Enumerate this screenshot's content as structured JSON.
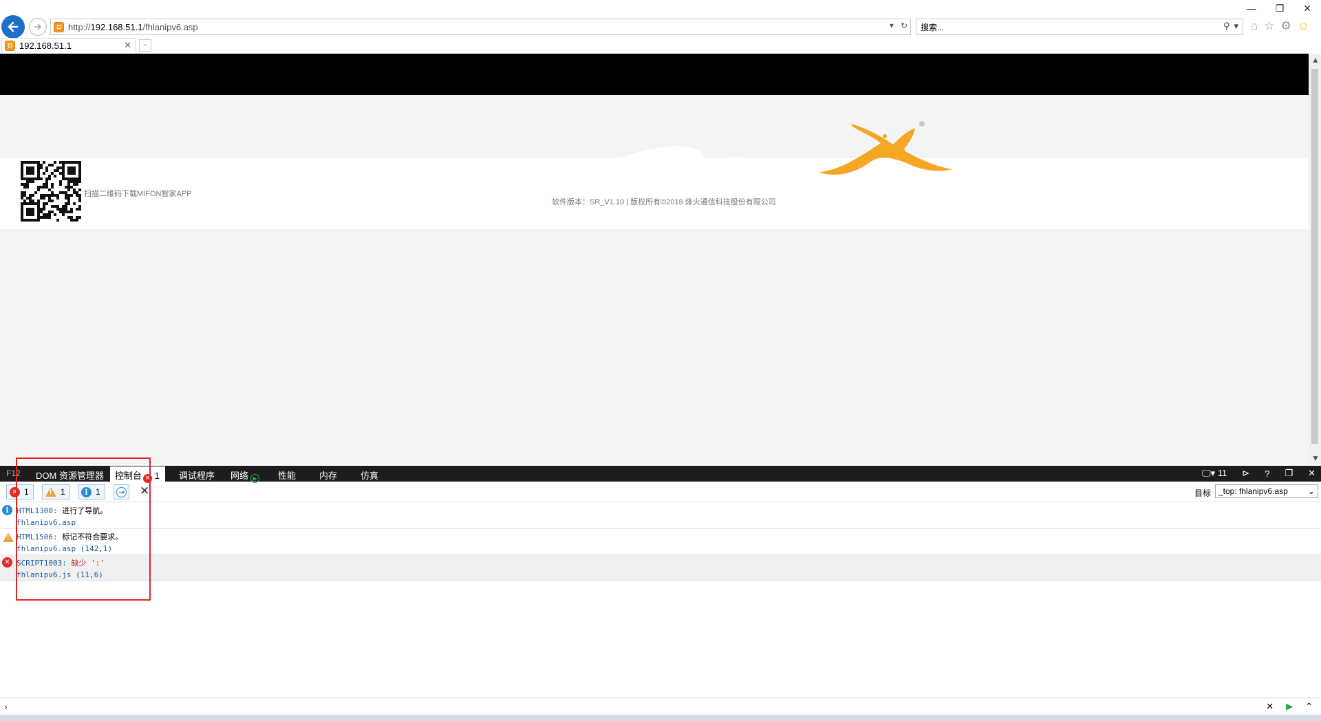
{
  "browser": {
    "url_prefix": "http://",
    "url_host": "192.168.51.1",
    "url_path": "/fhlanipv6.asp",
    "search_placeholder": "搜索...",
    "tab_title": "192.168.51.1"
  },
  "page": {
    "qr_caption": "扫描二维码下载MIFON智家APP",
    "footer": "软件版本：SR_V1.10 | 版权所有©2018 烽火通信科技股份有限公司",
    "colors": {
      "logo": "#f5a623",
      "header": "#000000"
    }
  },
  "devtools": {
    "f12_label": "F12",
    "tabs": [
      {
        "label": "DOM 资源管理器"
      },
      {
        "label": "控制台",
        "badge": "1"
      },
      {
        "label": "调试程序"
      },
      {
        "label": "网络"
      },
      {
        "label": "性能"
      },
      {
        "label": "内存"
      },
      {
        "label": "仿真"
      }
    ],
    "mode_value": "11",
    "filters": {
      "errors": "1",
      "warnings": "1",
      "info": "1"
    },
    "target_label": "目标",
    "target_value": "_top: fhlanipv6.asp",
    "messages": [
      {
        "level": "info",
        "code": "HTML1300",
        "text": "进行了导航。",
        "source": "fhlanipv6.asp"
      },
      {
        "level": "warning",
        "code": "HTML1506",
        "text": "标记不符合要求。",
        "source": "fhlanipv6.asp (142,1)"
      },
      {
        "level": "error",
        "code": "SCRIPT1003",
        "text": "缺少 ':'",
        "source": "fhlanipv6.js (11,6)"
      }
    ]
  }
}
